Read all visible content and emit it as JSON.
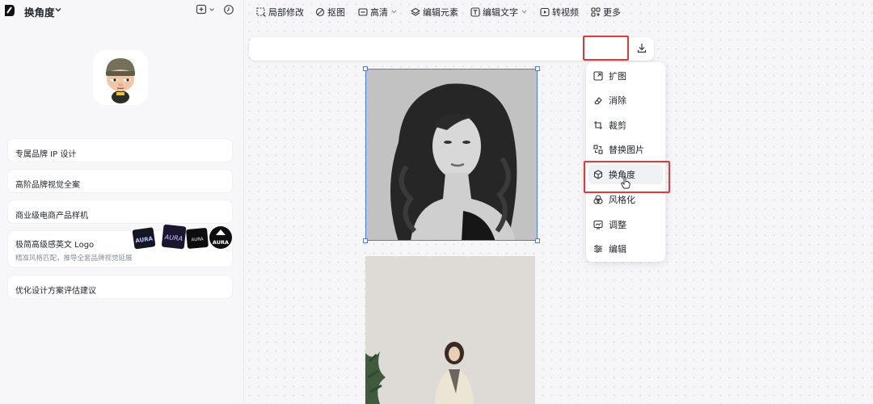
{
  "app": {
    "title": "换角度"
  },
  "sidebar": {
    "cards": [
      {
        "title": "专属品牌 IP 设计"
      },
      {
        "title": "高阶品牌视觉全案"
      },
      {
        "title": "商业级电商产品样机"
      },
      {
        "title": "极简高级感英文 Logo",
        "subtitle": "精准风格匹配，推导全套品牌视觉延展",
        "logo_text": "AURA"
      },
      {
        "title": "优化设计方案评估建议"
      }
    ]
  },
  "toolbar": {
    "items": [
      {
        "label": "局部修改",
        "icon": "crop-select-icon"
      },
      {
        "label": "抠图",
        "icon": "cutout-icon"
      },
      {
        "label": "高清",
        "icon": "hd-icon",
        "dropdown": true
      },
      {
        "label": "编辑元素",
        "icon": "layers-icon"
      },
      {
        "label": "编辑文字",
        "icon": "text-icon",
        "dropdown": true
      },
      {
        "label": "转视频",
        "icon": "video-icon"
      },
      {
        "label": "更多",
        "icon": "grid-icon"
      }
    ],
    "download_icon": "download-icon"
  },
  "menu": {
    "items": [
      {
        "label": "扩图",
        "icon": "expand-icon"
      },
      {
        "label": "消除",
        "icon": "eraser-icon"
      },
      {
        "label": "裁剪",
        "icon": "crop-icon"
      },
      {
        "label": "替换图片",
        "icon": "replace-icon"
      },
      {
        "label": "换角度",
        "icon": "angle-icon",
        "active": true
      },
      {
        "label": "风格化",
        "icon": "style-icon"
      },
      {
        "label": "调整",
        "icon": "adjust-icon"
      },
      {
        "label": "编辑",
        "icon": "edit-icon"
      }
    ]
  },
  "colors": {
    "highlight": "#e4393c",
    "selection": "#4a7cf0"
  }
}
